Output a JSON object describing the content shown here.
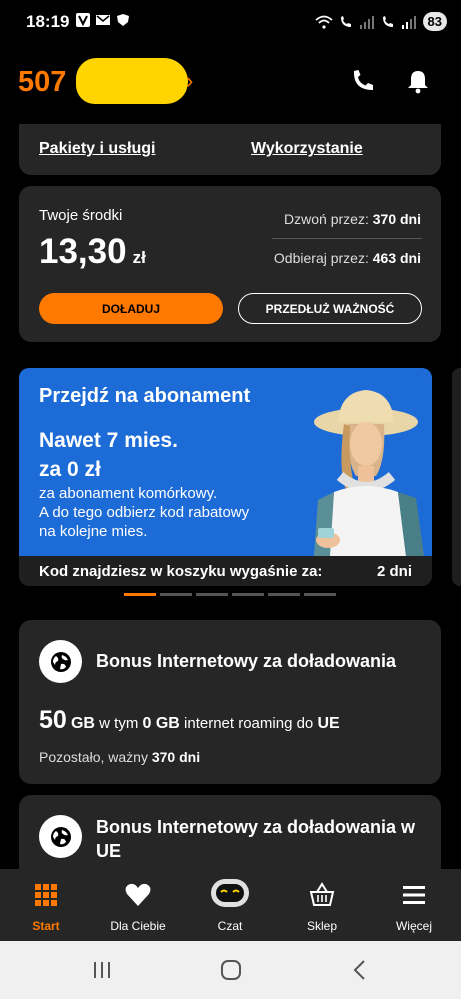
{
  "status_bar": {
    "time": "18:19",
    "battery": "83",
    "icons": [
      "vodafone-app-icon",
      "gmail-icon",
      "shield-icon",
      "wifi-icon",
      "wifi-call-icon",
      "signal-icon",
      "volte-call-icon",
      "signal-icon"
    ]
  },
  "header": {
    "account_number_prefix": "507",
    "chevron": "›"
  },
  "links": {
    "packages": "Pakiety i usługi",
    "usage": "Wykorzystanie"
  },
  "balance": {
    "label": "Twoje środki",
    "amount": "13,30",
    "currency": "zł",
    "call_label": "Dzwoń przez:",
    "call_value": "370 dni",
    "receive_label": "Odbieraj przez:",
    "receive_value": "463 dni",
    "topup_button": "DOŁADUJ",
    "extend_button": "PRZEDŁUŻ WAŻNOŚĆ"
  },
  "promo": {
    "title": "Przejdź na abonament",
    "headline_line1": "Nawet 7 mies.",
    "headline_line2": "za 0 zł",
    "desc_line1": "za abonament komórkowy.",
    "desc_line2": "A do tego odbierz kod rabatowy",
    "desc_line3": "na kolejne mies.",
    "footer_text": "Kod znajdziesz w koszyku wygaśnie za:",
    "footer_days": "2 dni",
    "colors": {
      "background": "#1c6bd6"
    }
  },
  "carousel": {
    "count": 6,
    "active_index": 0
  },
  "bonus_1": {
    "title": "Bonus Internetowy za doładowania",
    "amount": "50",
    "unit": "GB",
    "text1": "w tym",
    "roaming_amount": "0 GB",
    "text2": "internet roaming do",
    "region": "UE",
    "remaining_label": "Pozostało, ważny",
    "remaining_value": "370 dni"
  },
  "bonus_2": {
    "title": "Bonus Internetowy za doładowania w UE"
  },
  "bottom_nav": {
    "items": [
      {
        "label": "Start",
        "icon": "grid-icon"
      },
      {
        "label": "Dla Ciebie",
        "icon": "heart-icon"
      },
      {
        "label": "Czat",
        "icon": "chatbot-icon"
      },
      {
        "label": "Sklep",
        "icon": "basket-icon"
      },
      {
        "label": "Więcej",
        "icon": "menu-icon"
      }
    ],
    "active_index": 0
  },
  "colors": {
    "accent": "#ff7900",
    "card": "#262626",
    "background": "#000000"
  }
}
